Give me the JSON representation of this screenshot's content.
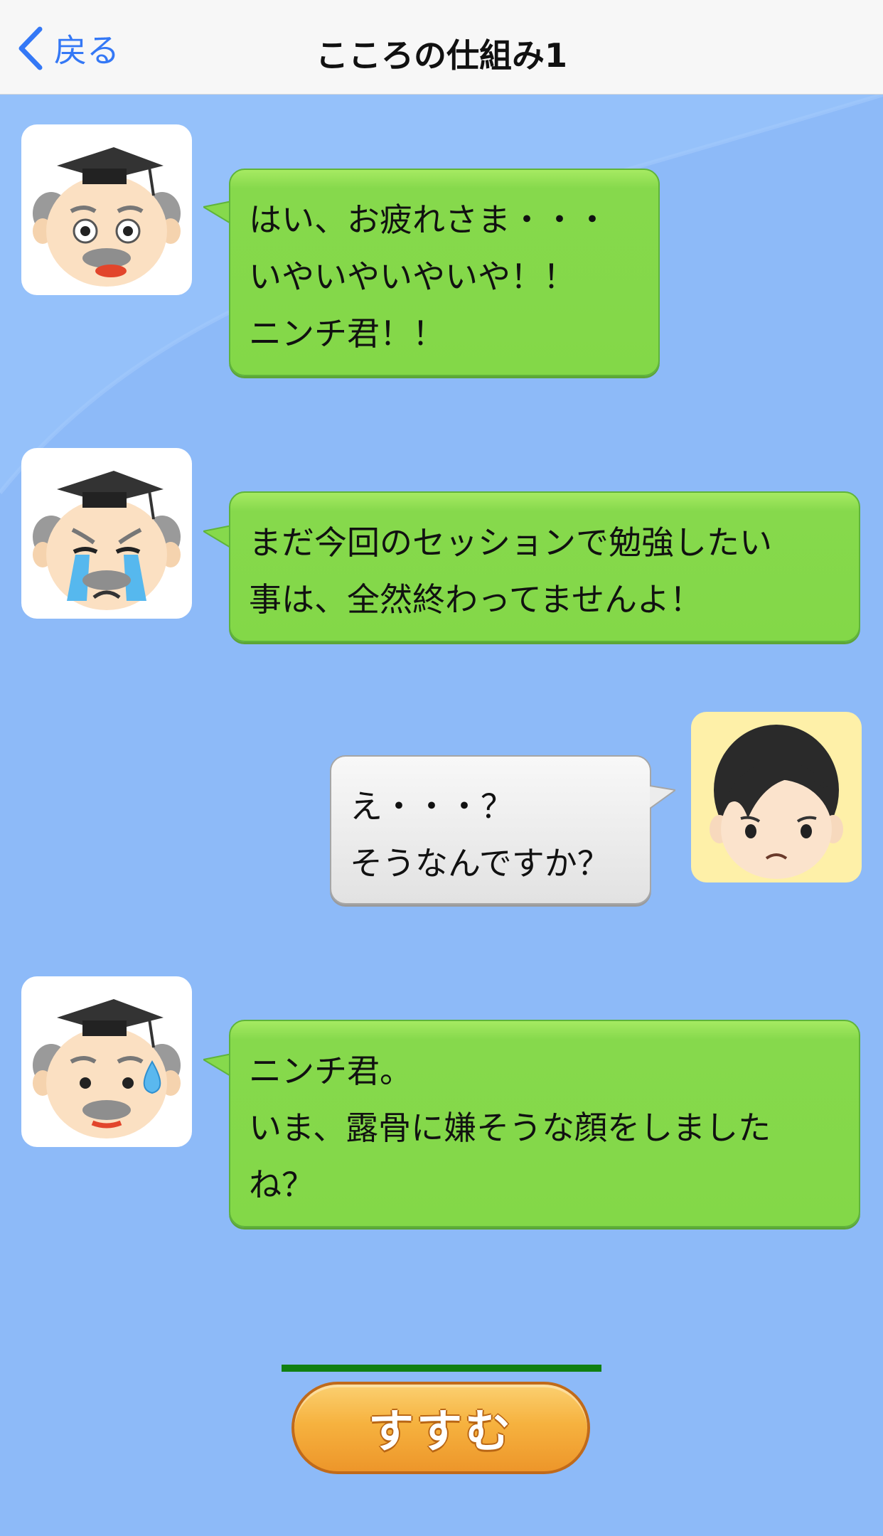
{
  "nav": {
    "back_label": "戻る",
    "title": "こころの仕組み1"
  },
  "messages": [
    {
      "speaker": "professor",
      "expression": "surprised",
      "text": "はい、お疲れさま・・・\nいやいやいやいや！！\nニンチ君！！"
    },
    {
      "speaker": "professor",
      "expression": "crying",
      "text": "まだ今回のセッションで勉強したい\n事は、全然終わってませんよ！"
    },
    {
      "speaker": "user",
      "expression": "worried",
      "text": "え・・・？\nそうなんですか？"
    },
    {
      "speaker": "professor",
      "expression": "sweating",
      "text": "ニンチ君。\nいま、露骨に嫌そうな顔をしました\nね？"
    }
  ],
  "footer": {
    "next_label": "すすむ"
  },
  "colors": {
    "background": "#8dbaf8",
    "bubble_professor": "#86d94c",
    "bubble_user": "#e8e8e8",
    "next_button": "#f6b23f",
    "progress": "#118011",
    "back_link": "#3478f6"
  },
  "icons": {
    "back": "chevron-left-icon"
  }
}
